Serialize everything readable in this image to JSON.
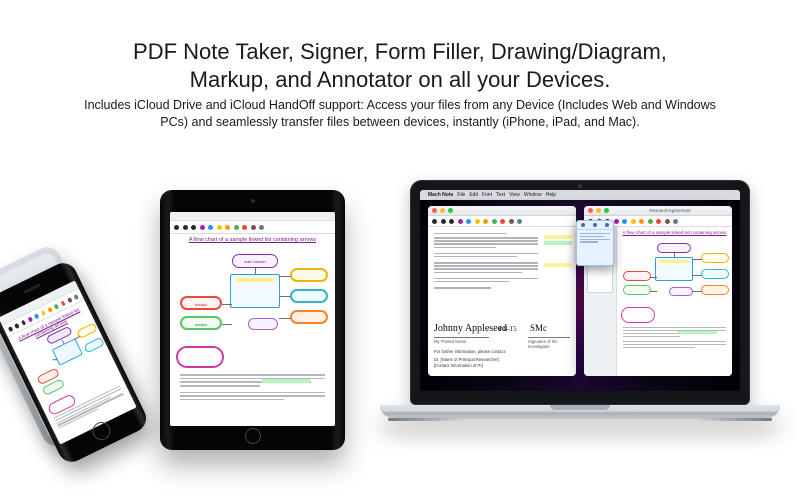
{
  "hero": {
    "title_line1": "PDF Note Taker, Signer, Form Filler, Drawing/Diagram,",
    "title_line2": "Markup, and Annotator on all your Devices.",
    "subtitle": "Includes iCloud Drive and iCloud HandOff support: Access your files from any Device (Includes Web and Windows PCs) and seamlessly transfer files between devices, instantly (iPhone, iPad, and Mac)."
  },
  "mac": {
    "menu": [
      "Mach Note",
      "File",
      "Edit",
      "Font",
      "Text",
      "View",
      "Window",
      "Help"
    ],
    "window_left_title": "",
    "window_right_title": "ResearchAgreement",
    "signature_name": "Johnny Appleseed",
    "signature_date": "4-8-15",
    "printed_name_label": "My Printed Name",
    "sig_invest_label": "Signature of the Investigator",
    "further_info": "For further information, please contact:",
    "researcher_line1": "Dr. [Name of Principal Researcher]",
    "researcher_line2": "[Contact Information of PI]"
  },
  "doc": {
    "title": "A flow chart of a sample linked list containing arrows",
    "nodes": {
      "main_header": "main header",
      "essays_a": "essays",
      "essays_b": "essays",
      "third": "",
      "fourth": ""
    }
  },
  "tool_colors": [
    "#2a2a2a",
    "#2a2a2a",
    "#2a2a2a",
    "#9c27b0",
    "#2196f3",
    "#ffc107",
    "#ff9800",
    "#4caf50",
    "#f44336",
    "#795548",
    "#607d8b"
  ],
  "traffic": {
    "red": "#ff5f57",
    "yellow": "#febc2e",
    "green": "#28c840"
  }
}
